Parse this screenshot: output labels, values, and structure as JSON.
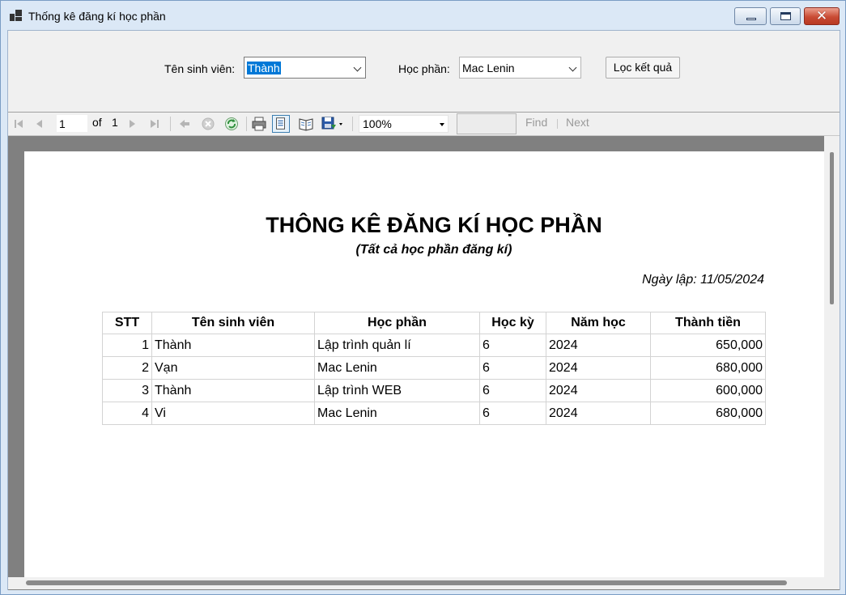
{
  "window": {
    "title": "Thống kê đăng kí học phần"
  },
  "filters": {
    "student_label": "Tên sinh viên:",
    "student_value": "Thành",
    "course_label": "Học phần:",
    "course_value": "Mac Lenin",
    "filter_button": "Lọc kết quả"
  },
  "toolbar": {
    "page_current": "1",
    "of_label": "of",
    "page_total": "1",
    "zoom": "100%",
    "find_label": "Find",
    "next_label": "Next"
  },
  "report": {
    "title": "THÔNG KÊ ĐĂNG KÍ HỌC PHẦN",
    "subtitle": "(Tất cả học phần đăng kí)",
    "date": "Ngày lập: 11/05/2024",
    "columns": [
      "STT",
      "Tên sinh viên",
      "Học phần",
      "Học kỳ",
      "Năm học",
      "Thành tiền"
    ],
    "rows": [
      [
        "1",
        "Thành",
        "Lập trình quản lí",
        "6",
        "2024",
        "650,000"
      ],
      [
        "2",
        "Vạn",
        "Mac Lenin",
        "6",
        "2024",
        "680,000"
      ],
      [
        "3",
        "Thành",
        "Lập trình WEB",
        "6",
        "2024",
        "600,000"
      ],
      [
        "4",
        "Vi",
        "Mac Lenin",
        "6",
        "2024",
        "680,000"
      ]
    ]
  }
}
